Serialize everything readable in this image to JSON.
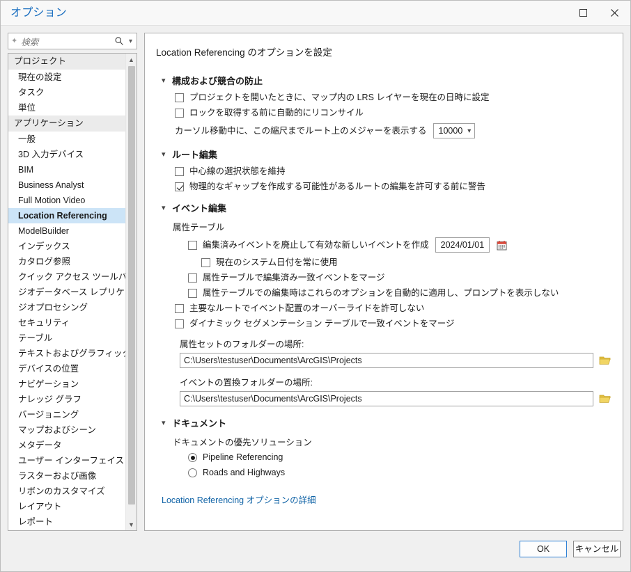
{
  "window": {
    "title": "オプション",
    "maximize_icon": "maximize-icon",
    "close_icon": "close-icon"
  },
  "sidebar": {
    "search": {
      "placeholder": "検索",
      "sparkle_icon": "sparkle-icon",
      "search_icon": "search-icon",
      "dropdown_icon": "chevron-down-icon"
    },
    "groups": [
      {
        "label": "プロジェクト",
        "items": [
          {
            "label": "現在の設定",
            "selected": false
          },
          {
            "label": "タスク",
            "selected": false
          },
          {
            "label": "単位",
            "selected": false
          }
        ]
      },
      {
        "label": "アプリケーション",
        "items": [
          {
            "label": "一般",
            "selected": false
          },
          {
            "label": "3D 入力デバイス",
            "selected": false
          },
          {
            "label": "BIM",
            "selected": false
          },
          {
            "label": "Business Analyst",
            "selected": false
          },
          {
            "label": "Full Motion Video",
            "selected": false
          },
          {
            "label": "Location Referencing",
            "selected": true
          },
          {
            "label": "ModelBuilder",
            "selected": false
          },
          {
            "label": "インデックス",
            "selected": false
          },
          {
            "label": "カタログ参照",
            "selected": false
          },
          {
            "label": "クイック アクセス ツールバー",
            "selected": false
          },
          {
            "label": "ジオデータベース レプリケーション",
            "selected": false
          },
          {
            "label": "ジオプロセシング",
            "selected": false
          },
          {
            "label": "セキュリティ",
            "selected": false
          },
          {
            "label": "テーブル",
            "selected": false
          },
          {
            "label": "テキストおよびグラフィックス",
            "selected": false
          },
          {
            "label": "デバイスの位置",
            "selected": false
          },
          {
            "label": "ナビゲーション",
            "selected": false
          },
          {
            "label": "ナレッジ グラフ",
            "selected": false
          },
          {
            "label": "バージョニング",
            "selected": false
          },
          {
            "label": "マップおよびシーン",
            "selected": false
          },
          {
            "label": "メタデータ",
            "selected": false
          },
          {
            "label": "ユーザー インターフェイス",
            "selected": false
          },
          {
            "label": "ラスターおよび画像",
            "selected": false
          },
          {
            "label": "リボンのカスタマイズ",
            "selected": false
          },
          {
            "label": "レイアウト",
            "selected": false
          },
          {
            "label": "レポート",
            "selected": false
          }
        ]
      }
    ],
    "scroll_up_icon": "chevron-up-icon",
    "scroll_down_icon": "chevron-down-icon"
  },
  "main": {
    "title": "Location Referencing のオプションを設定",
    "sections": {
      "conflict": {
        "header": "構成および競合の防止",
        "cb_set_lrs_date": {
          "label": "プロジェクトを開いたときに、マップ内の LRS レイヤーを現在の日時に設定",
          "checked": false
        },
        "cb_auto_reconcile": {
          "label": "ロックを取得する前に自動的にリコンサイル",
          "checked": false
        },
        "scale_label": "カーソル移動中に、この縮尺までルート上のメジャーを表示する",
        "scale_value": "10000"
      },
      "route_edit": {
        "header": "ルート編集",
        "cb_keep_centerline": {
          "label": "中心線の選択状態を維持",
          "checked": false
        },
        "cb_warn_gaps": {
          "label": "物理的なギャップを作成する可能性があるルートの編集を許可する前に警告",
          "checked": true
        }
      },
      "event_edit": {
        "header": "イベント編集",
        "attr_table_label": "属性テーブル",
        "cb_retire_create": {
          "label": "編集済みイベントを廃止して有効な新しいイベントを作成",
          "checked": false
        },
        "date_value": "2024/01/01",
        "calendar_icon": "calendar-icon",
        "cb_always_system_date": {
          "label": "現在のシステム日付を常に使用",
          "checked": false
        },
        "cb_merge_attr_table": {
          "label": "属性テーブルで編集済み一致イベントをマージ",
          "checked": false
        },
        "cb_auto_apply_no_prompt": {
          "label": "属性テーブルでの編集時はこれらのオプションを自動的に適用し、プロンプトを表示しない",
          "checked": false
        },
        "cb_no_override_dominant": {
          "label": "主要なルートでイベント配置のオーバーライドを許可しない",
          "checked": false
        },
        "cb_merge_dynseg": {
          "label": "ダイナミック セグメンテーション テーブルで一致イベントをマージ",
          "checked": false
        },
        "attr_set_folder_label": "属性セットのフォルダーの場所:",
        "attr_set_folder_value": "C:\\Users\\testuser\\Documents\\ArcGIS\\Projects",
        "event_replace_folder_label": "イベントの置換フォルダーの場所:",
        "event_replace_folder_value": "C:\\Users\\testuser\\Documents\\ArcGIS\\Projects",
        "browse_icon": "folder-open-icon"
      },
      "document": {
        "header": "ドキュメント",
        "preferred_solution_label": "ドキュメントの優先ソリューション",
        "radio_pipeline": {
          "label": "Pipeline Referencing",
          "selected": true
        },
        "radio_roads": {
          "label": "Roads and Highways",
          "selected": false
        }
      }
    },
    "help_link": "Location Referencing オプションの詳細"
  },
  "footer": {
    "ok_label": "OK",
    "cancel_label": "キャンセル"
  },
  "colors": {
    "title_blue": "#1b6fc0",
    "link_blue": "#1063a6",
    "selection_blue": "#cce4f7",
    "accent_border": "#2b7fd4",
    "folder_yellow": "#e8c44a"
  }
}
